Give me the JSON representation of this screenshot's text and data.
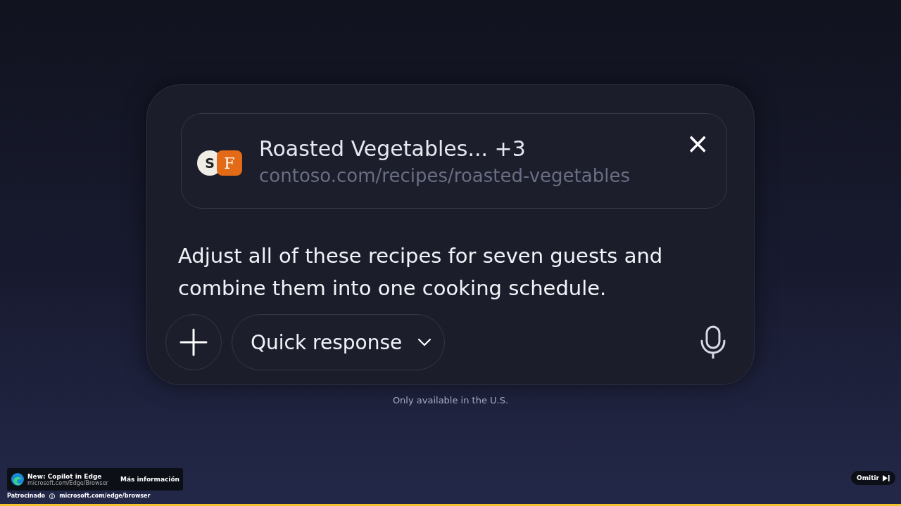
{
  "attachment": {
    "badges": [
      {
        "letter": "S",
        "kind": "circle"
      },
      {
        "letter": "F",
        "kind": "square"
      }
    ],
    "title": "Roasted Vegetables... +3",
    "url": "contoso.com/recipes/roasted-vegetables",
    "close": "×"
  },
  "prompt": "Adjust all of these recipes for seven guests and combine them into one cooking schedule.",
  "mode_button": {
    "label": "Quick response"
  },
  "footnote": "Only available in the U.S.",
  "ad": {
    "title": "New: Copilot in Edge",
    "url": "microsoft.com/Edge/Browser",
    "link": "Más información",
    "sponsored": "Patrocinado",
    "info": "ⓘ",
    "domain": "microsoft.com/edge/browser",
    "skip": "Omitir",
    "progress": {
      "level": 1
    }
  }
}
